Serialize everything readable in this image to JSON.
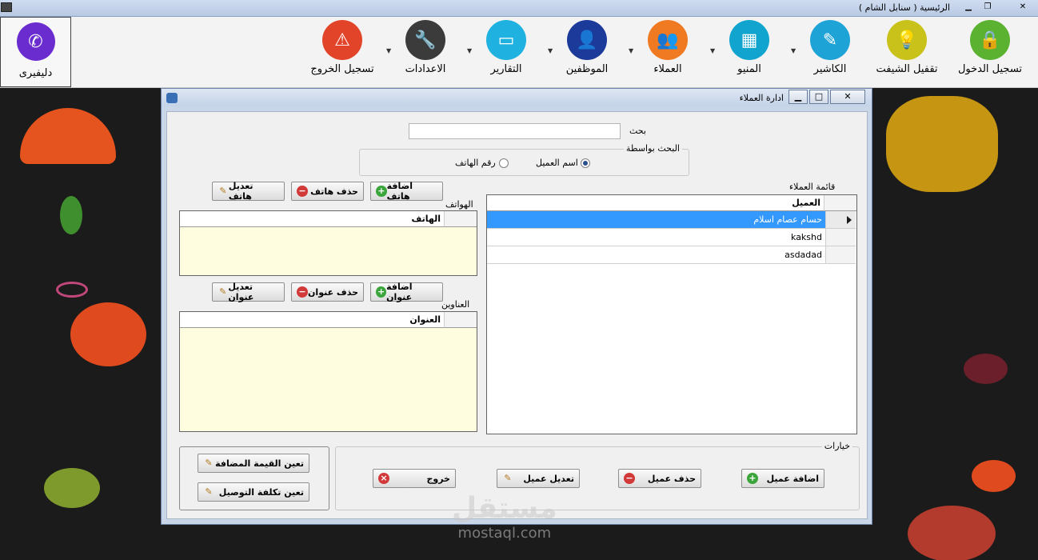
{
  "main_window": {
    "title": "الرئيسية  ( سنابل الشام )",
    "controls": {
      "minimize": "▁",
      "restore": "❐",
      "close": "✕"
    }
  },
  "toolbar": {
    "delivery": {
      "label": "دليفيرى",
      "icon": "phone-icon"
    },
    "items": [
      {
        "label": "تسجيل الدخول",
        "icon": "lock-icon",
        "color": "#5bb231"
      },
      {
        "label": "تقفيل الشيفت",
        "icon": "lightbulb-icon",
        "color": "#c8c21a"
      },
      {
        "label": "الكاشير",
        "icon": "edit-document-icon",
        "color": "#1ea3d6"
      },
      {
        "label": "المنيو",
        "icon": "grid-menu-icon",
        "color": "#10a4cf"
      },
      {
        "label": "العملاء",
        "icon": "customers-icon",
        "color": "#f07a22"
      },
      {
        "label": "الموظفين",
        "icon": "employees-icon",
        "color": "#1b3a9a"
      },
      {
        "label": "التقارير",
        "icon": "reports-icon",
        "color": "#1fb1df"
      },
      {
        "label": "الاعدادات",
        "icon": "wrench-icon",
        "color": "#3b3b3b"
      },
      {
        "label": "تسجيل الخروج",
        "icon": "warning-icon",
        "color": "#e2442a"
      }
    ]
  },
  "dialog": {
    "title": "ادارة العملاء",
    "controls": {
      "minimize": "▁",
      "maximize": "□",
      "close": "✕"
    },
    "search": {
      "label": "بحث",
      "value": "",
      "search_by_title": "البحث بواسطة",
      "options": [
        "اسم العميل",
        "رقم الهاتف"
      ],
      "selected": "اسم العميل"
    },
    "phones": {
      "title": "الهواتف",
      "add": "اضافة هاتف",
      "delete": "حذف هاتف",
      "edit": "تعديل هاتف",
      "column": "الهاتف",
      "rows": []
    },
    "addresses": {
      "title": "العناوين",
      "add": "اضافة عنوان",
      "delete": "حذف عنوان",
      "edit": "تعديل عنوان",
      "column": "العنوان",
      "rows": []
    },
    "customers": {
      "title": "قائمة العملاء",
      "column": "العميل",
      "rows": [
        "حسام عصام اسلام",
        "kakshd",
        "asdadad"
      ],
      "selected_index": 0
    },
    "options": {
      "title": "خيارات",
      "add": "اضافة عميل",
      "delete": "حذف عميل",
      "edit": "تعديل عميل",
      "exit": "خروج"
    },
    "extra": {
      "vat": "تعين القيمة المضافة",
      "delivery_cost": "تعين تكلفة التوصيل"
    }
  },
  "watermark": {
    "line1": "مستقل",
    "line2": "mostaql.com"
  }
}
